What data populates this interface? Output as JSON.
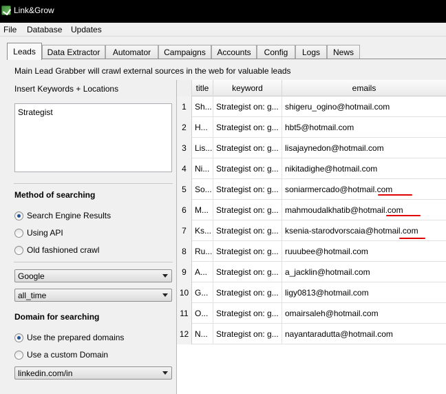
{
  "window": {
    "title": "Link&Grow"
  },
  "menu": [
    "File",
    "Database",
    "Updates"
  ],
  "tabs": [
    "Leads",
    "Data Extractor",
    "Automator",
    "Campaigns",
    "Accounts",
    "Config",
    "Logs",
    "News"
  ],
  "active_tab": "Leads",
  "description": "Main Lead Grabber will crawl external sources in the web for valuable leads",
  "keywords": {
    "label": "Insert Keywords + Locations",
    "value": "Strategist"
  },
  "method": {
    "title": "Method of searching",
    "options": [
      "Search Engine Results",
      "Using API",
      "Old fashioned crawl"
    ],
    "selected": 0
  },
  "engine_select": "Google",
  "time_select": "all_time",
  "domain": {
    "title": "Domain for searching",
    "options": [
      "Use the prepared domains",
      "Use a custom Domain"
    ],
    "selected": 0,
    "select_value": "linkedin.com/in"
  },
  "table": {
    "columns": [
      "title",
      "keyword",
      "emails"
    ],
    "rows": [
      {
        "n": "1",
        "title": "Sh...",
        "keyword": "Strategist  on: g...",
        "email": "shigeru_ogino@hotmail.com"
      },
      {
        "n": "2",
        "title": "H...",
        "keyword": "Strategist  on: g...",
        "email": "hbt5@hotmail.com"
      },
      {
        "n": "3",
        "title": "Lis...",
        "keyword": "Strategist  on: g...",
        "email": "lisajaynedon@hotmail.com"
      },
      {
        "n": "4",
        "title": "Ni...",
        "keyword": "Strategist  on: g...",
        "email": "nikitadighe@hotmail.com"
      },
      {
        "n": "5",
        "title": "So...",
        "keyword": "Strategist  on: g...",
        "email": "soniarmercado@hotmail.com"
      },
      {
        "n": "6",
        "title": "M...",
        "keyword": "Strategist  on: g...",
        "email": "mahmoudalkhatib@hotmail.com"
      },
      {
        "n": "7",
        "title": "Ks...",
        "keyword": "Strategist  on: g...",
        "email": "ksenia-starodvorscaia@hotmail.com"
      },
      {
        "n": "8",
        "title": "Ru...",
        "keyword": "Strategist  on: g...",
        "email": "ruuubee@hotmail.com"
      },
      {
        "n": "9",
        "title": "A...",
        "keyword": "Strategist  on: g...",
        "email": "a_jacklin@hotmail.com"
      },
      {
        "n": "10",
        "title": "G...",
        "keyword": "Strategist  on: g...",
        "email": "ligy0813@hotmail.com"
      },
      {
        "n": "11",
        "title": "O...",
        "keyword": "Strategist  on: g...",
        "email": "omairsaleh@hotmail.com"
      },
      {
        "n": "12",
        "title": "N...",
        "keyword": "Strategist  on: g...",
        "email": "nayantaradutta@hotmail.com"
      }
    ]
  },
  "colors": {
    "titlebar": "#000000",
    "annotation": "#e00000",
    "radio_dot": "#1f4f9a"
  }
}
